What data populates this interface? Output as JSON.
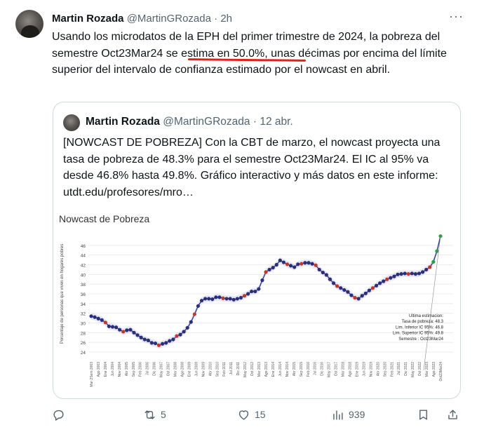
{
  "tweet": {
    "author_name": "Martin Rozada",
    "handle": "@MartinGRozada",
    "separator": "·",
    "time": "2h",
    "text_before": "Usando los microdatos de la EPH del primer trimestre de 2024, la pobreza del semestre Oct23Mar24 ",
    "text_underlined": "se estima en 50.0%,",
    "text_after": " unas décimas por encima del límite superior del intervalo de confianza estimado por el nowcast en abril.",
    "underline_color": "#e0201a"
  },
  "quote": {
    "author_name": "Martin Rozada",
    "handle": "@MartinGRozada",
    "separator": "·",
    "time": "12 abr.",
    "text": "[NOWCAST DE POBREZA] Con la CBT de marzo, el nowcast proyecta una tasa de pobreza de 48.3% para el semestre Oct23Mar24. El IC al 95% va desde 46.8% hasta 49.8%. Gráfico interactivo y más datos en este informe: utdt.edu/profesores/mro…"
  },
  "chart_data": {
    "type": "line",
    "title": "Nowcast de Pobreza",
    "ylabel": "Porcentaje de personas que viven en hogares pobres",
    "ylim": [
      24,
      48
    ],
    "yticks": [
      24,
      26,
      28,
      30,
      32,
      34,
      36,
      38,
      40,
      42,
      44,
      46
    ],
    "grid": true,
    "series": [
      {
        "name": "",
        "color": "#2a2f7a",
        "values": [
          31.4,
          31.2,
          30.9,
          30.6,
          30.1,
          29.3,
          29.2,
          29.1,
          28.6,
          28.2,
          28.5,
          28.6,
          28.0,
          27.5,
          27.0,
          26.6,
          26.4,
          25.9,
          25.8,
          25.4,
          25.7,
          25.9,
          26.3,
          26.6,
          27.3,
          27.6,
          28.2,
          29.0,
          30.2,
          31.8,
          33.5,
          34.6,
          35.0,
          35.0,
          34.9,
          35.3,
          35.3,
          35.1,
          35.0,
          35.0,
          34.8,
          35.0,
          35.2,
          35.6,
          36.0,
          36.5,
          36.5,
          37.0,
          38.8,
          40.5,
          41.0,
          41.4,
          42.0,
          42.9,
          42.5,
          42.1,
          41.8,
          41.5,
          42.1,
          42.2,
          42.4,
          42.4,
          42.2,
          41.9,
          41.0,
          40.4,
          39.9,
          39.0,
          38.2,
          37.6,
          37.2,
          36.8,
          36.4,
          35.7,
          35.2,
          35.0,
          35.6,
          36.1,
          36.7,
          37.2,
          37.7,
          38.2,
          38.6,
          39.0,
          39.3,
          39.6,
          40.0,
          40.1,
          40.2,
          40.1,
          40.2,
          40.1,
          40.2,
          40.5,
          41.0,
          41.5,
          42.6,
          44.8,
          47.9
        ],
        "red_points": [
          4,
          9,
          19,
          24,
          29,
          37,
          43,
          49,
          55,
          59,
          63,
          69,
          74,
          79,
          83,
          89,
          95
        ]
      }
    ],
    "x_labels": [
      "Mar 2Sem 2003",
      "Ago 2003",
      "Ene 2004",
      "Jun 2004",
      "Nov 2004",
      "Abr 2005",
      "Sep 2005",
      "Feb 2006",
      "Jul 2006",
      "Dic 2006",
      "May 2007",
      "Oct 2007",
      "Mar 2008",
      "Ago 2008",
      "Ene 2009",
      "Jun 2009",
      "Nov 2009",
      "Abr 2010",
      "Sep 2010",
      "Feb 2011",
      "Jul 2011",
      "Dic 2011",
      "May 2012",
      "Oct 2012",
      "Mar 2013",
      "Ago 2013",
      "Ene 2014",
      "Jun 2014",
      "Nov 2014",
      "Abr 2015",
      "Sep 2015",
      "Feb 2016",
      "Jul 2016",
      "Dic 2016",
      "May 2017",
      "Oct 2017",
      "Mar 2018",
      "Ago 2018",
      "Ene 2019",
      "Jun 2019",
      "Nov 2019",
      "Abr 2020",
      "Sep 2020",
      "Feb 2021",
      "Jul 2021",
      "Dic 2021",
      "May 2022",
      "Oct 2022",
      "Mar 2023",
      "Ago 2023",
      "Oct23Mar24"
    ],
    "annotation_lines": [
      "Ultima estimacion:",
      "Tasa de pobreza:  48.3",
      "Lim. Inferior IC 95%:  46.8",
      "Lim. Superior IC 95%:  49.8",
      "Semestre : Oct23Mar24"
    ],
    "colors": {
      "line": "#2a2f7a",
      "red": "#c0392b",
      "green": "#2e9d48",
      "band": "#d7d7ea"
    }
  },
  "actions": {
    "reply": "",
    "retweet": "5",
    "like": "15",
    "views": "939"
  }
}
